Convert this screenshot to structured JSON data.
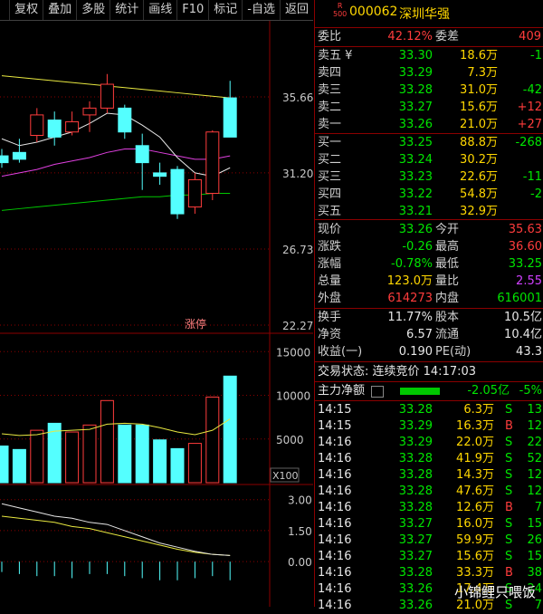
{
  "toolbar": {
    "items": [
      "复权",
      "叠加",
      "多股",
      "统计",
      "画线",
      "F10",
      "标记",
      "-自选",
      "返回"
    ]
  },
  "stock": {
    "code": "000062",
    "name": "深圳华强",
    "badge_top": "R",
    "badge_bottom": "500"
  },
  "ratio": {
    "label1": "委比",
    "value1": "42.12%",
    "label2": "委差",
    "value2": "409"
  },
  "asks": [
    {
      "label": "卖五 ¥",
      "price": "33.30",
      "vol": "18.6万",
      "chg": "-1"
    },
    {
      "label": "卖四",
      "price": "33.29",
      "vol": "7.3万",
      "chg": ""
    },
    {
      "label": "卖三",
      "price": "33.28",
      "vol": "31.0万",
      "chg": "-42"
    },
    {
      "label": "卖二",
      "price": "33.27",
      "vol": "15.6万",
      "chg": "+12"
    },
    {
      "label": "卖一",
      "price": "33.26",
      "vol": "21.0万",
      "chg": "+27"
    }
  ],
  "bids": [
    {
      "label": "买一",
      "price": "33.25",
      "vol": "88.8万",
      "chg": "-268"
    },
    {
      "label": "买二",
      "price": "33.24",
      "vol": "30.2万",
      "chg": ""
    },
    {
      "label": "买三",
      "price": "33.23",
      "vol": "22.6万",
      "chg": "-11"
    },
    {
      "label": "买四",
      "price": "33.22",
      "vol": "54.8万",
      "chg": "-2"
    },
    {
      "label": "买五",
      "price": "33.21",
      "vol": "32.9万",
      "chg": ""
    }
  ],
  "quote": [
    {
      "l1": "现价",
      "v1": "33.26",
      "l2": "今开",
      "v2": "35.63"
    },
    {
      "l1": "涨跌",
      "v1": "-0.26",
      "l2": "最高",
      "v2": "36.60"
    },
    {
      "l1": "涨幅",
      "v1": "-0.78%",
      "l2": "最低",
      "v2": "33.25"
    },
    {
      "l1": "总量",
      "v1": "123.0万",
      "l2": "量比",
      "v2": "2.55"
    },
    {
      "l1": "外盘",
      "v1": "614273",
      "l2": "内盘",
      "v2": "616001"
    }
  ],
  "fund": [
    {
      "l1": "换手",
      "v1": "11.77%",
      "l2": "股本",
      "v2": "10.5亿"
    },
    {
      "l1": "净资",
      "v1": "6.57",
      "l2": "流通",
      "v2": "10.4亿"
    },
    {
      "l1": "收益(一)",
      "v1": "0.190",
      "l2": "PE(动)",
      "v2": "43.3"
    }
  ],
  "trade_status": "交易状态: 连续竞价 14:17:03",
  "main_flow": {
    "label": "主力净额",
    "value": "-2.05亿",
    "pct": "-5%"
  },
  "ticks": [
    {
      "t": "14:15",
      "p": "33.28",
      "v": "6.3万",
      "d": "S",
      "n": "13"
    },
    {
      "t": "14:15",
      "p": "33.29",
      "v": "16.3万",
      "d": "B",
      "n": "12"
    },
    {
      "t": "14:16",
      "p": "33.29",
      "v": "22.0万",
      "d": "S",
      "n": "22"
    },
    {
      "t": "14:16",
      "p": "33.28",
      "v": "41.9万",
      "d": "S",
      "n": "52"
    },
    {
      "t": "14:16",
      "p": "33.28",
      "v": "14.3万",
      "d": "S",
      "n": "12"
    },
    {
      "t": "14:16",
      "p": "33.28",
      "v": "47.6万",
      "d": "S",
      "n": "12"
    },
    {
      "t": "14:16",
      "p": "33.28",
      "v": "12.6万",
      "d": "B",
      "n": "7"
    },
    {
      "t": "14:16",
      "p": "33.27",
      "v": "16.0万",
      "d": "S",
      "n": "15"
    },
    {
      "t": "14:16",
      "p": "33.27",
      "v": "59.9万",
      "d": "S",
      "n": "26"
    },
    {
      "t": "14:16",
      "p": "33.27",
      "v": "15.6万",
      "d": "S",
      "n": "15"
    },
    {
      "t": "14:16",
      "p": "33.28",
      "v": "33.3万",
      "d": "B",
      "n": "38"
    },
    {
      "t": "14:16",
      "p": "33.26",
      "v": "17.4万",
      "d": "S",
      "n": "24"
    },
    {
      "t": "14:16",
      "p": "33.26",
      "v": "21.0万",
      "d": "S",
      "n": "7"
    }
  ],
  "axis": {
    "price_ticks": [
      "35.66",
      "31.20",
      "26.73",
      "22.27"
    ],
    "vol_ticks": [
      "15000",
      "10000",
      "5000"
    ],
    "vol_unit": "X100",
    "macd_ticks": [
      "3.00",
      "1.50",
      "0.00"
    ],
    "limit_tag": "涨停"
  },
  "chart_data": {
    "type": "candlestick",
    "candles": [
      {
        "o": 32.2,
        "c": 31.8,
        "h": 32.6,
        "l": 31.5
      },
      {
        "o": 32.4,
        "c": 32.0,
        "h": 33.2,
        "l": 31.8
      },
      {
        "o": 33.4,
        "c": 34.6,
        "h": 35.0,
        "l": 33.0
      },
      {
        "o": 34.3,
        "c": 33.3,
        "h": 34.8,
        "l": 32.8
      },
      {
        "o": 33.6,
        "c": 34.2,
        "h": 34.8,
        "l": 33.4
      },
      {
        "o": 34.6,
        "c": 35.0,
        "h": 35.4,
        "l": 33.6
      },
      {
        "o": 35.0,
        "c": 36.4,
        "h": 37.0,
        "l": 34.7
      },
      {
        "o": 35.0,
        "c": 33.6,
        "h": 35.2,
        "l": 33.2
      },
      {
        "o": 32.8,
        "c": 31.8,
        "h": 33.5,
        "l": 30.2
      },
      {
        "o": 31.2,
        "c": 31.0,
        "h": 31.8,
        "l": 30.5
      },
      {
        "o": 31.4,
        "c": 28.8,
        "h": 31.6,
        "l": 28.5
      },
      {
        "o": 29.2,
        "c": 30.8,
        "h": 31.2,
        "l": 28.8
      },
      {
        "o": 30.0,
        "c": 33.6,
        "h": 33.7,
        "l": 29.6
      },
      {
        "o": 35.6,
        "c": 33.3,
        "h": 36.6,
        "l": 33.3
      }
    ],
    "ma5": [
      33.2,
      32.8,
      33.0,
      33.3,
      33.6,
      34.1,
      34.7,
      34.6,
      34.0,
      33.3,
      32.1,
      31.2,
      31.0,
      31.5
    ],
    "ma10": [
      31.0,
      31.2,
      31.4,
      31.7,
      31.9,
      32.1,
      32.4,
      32.6,
      32.6,
      32.4,
      32.2,
      32.0,
      32.0,
      32.2
    ],
    "ma20": [
      29.0,
      29.1,
      29.2,
      29.3,
      29.4,
      29.5,
      29.6,
      29.7,
      29.8,
      29.8,
      29.9,
      29.9,
      30.0,
      30.0
    ],
    "ma_long": [
      36.9,
      36.8,
      36.7,
      36.6,
      36.5,
      36.4,
      36.3,
      36.2,
      36.1,
      36.0,
      35.9,
      35.8,
      35.7,
      35.6
    ],
    "volume": [
      4200,
      3800,
      6000,
      6800,
      5800,
      6600,
      9400,
      6600,
      6600,
      4900,
      3900,
      4500,
      9800,
      12200
    ],
    "volume_ma": [
      5600,
      5400,
      5500,
      5900,
      6000,
      6100,
      6700,
      6800,
      6700,
      6300,
      5800,
      5500,
      6000,
      7300
    ],
    "macd_dif": [
      2.8,
      2.6,
      2.4,
      2.2,
      2.1,
      1.9,
      1.8,
      1.5,
      1.2,
      0.9,
      0.7,
      0.5,
      0.35,
      0.3
    ],
    "macd_dea": [
      2.2,
      2.1,
      2.0,
      1.9,
      1.7,
      1.6,
      1.4,
      1.2,
      1.0,
      0.8,
      0.6,
      0.45,
      0.35,
      0.3
    ],
    "macd_hist": [
      -0.5,
      -0.6,
      -0.7,
      -0.7,
      -0.8,
      -0.6,
      -0.6,
      -0.7,
      -0.8,
      -0.9,
      -0.9,
      -0.8,
      -0.7,
      -0.9
    ],
    "price_range": [
      22.27,
      40.12
    ],
    "volume_range": [
      0,
      17000
    ],
    "macd_range": [
      -1.0,
      3.6
    ]
  },
  "watermark": "小锦鲤只喂饭"
}
